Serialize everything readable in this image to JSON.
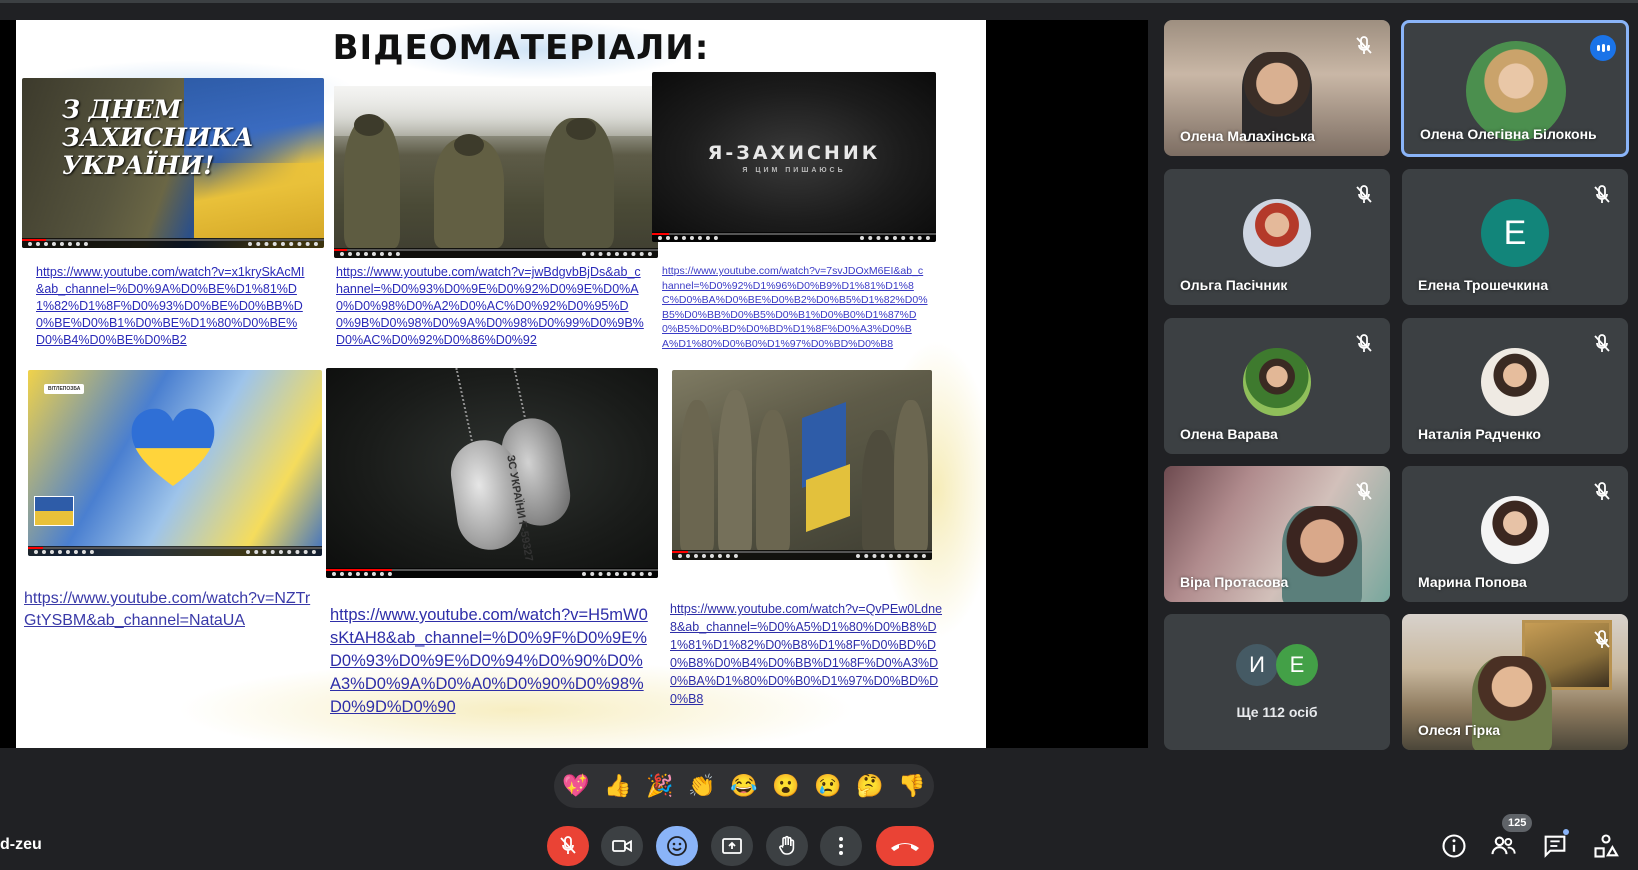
{
  "slide": {
    "title": "ВІДЕОМАТЕРІАЛИ:",
    "thumb1_overlay": "З ДНЕМ\nЗАХИСНИКА\nУКРАЇНИ!",
    "thumb3_big": "Я-ЗАХИСНИК",
    "thumb3_small": "Я ЦИМ ПИШАЮСЬ",
    "thumb4_tag": "ВІТЛЕПОЗБА",
    "thumb5_tagtext": "ЗС УКРАЇНИ Г-59327",
    "links": [
      "https://www.youtube.com/watch?v=x1krySkAcMI&ab_channel=%D0%9A%D0%BE%D1%81%D1%82%D1%8F%D0%93%D0%BE%D0%BB%D0%BE%D0%B1%D0%BE%D1%80%D0%BE%D0%B4%D0%BE%D0%B2",
      "https://www.youtube.com/watch?v=jwBdgvbBjDs&ab_channel=%D0%93%D0%9E%D0%92%D0%9E%D0%A0%D0%98%D0%A2%D0%AC%D0%92%D0%95%D0%9B%D0%98%D0%9A%D0%98%D0%99%D0%9B%D0%AC%D0%92%D0%86%D0%92",
      "https://www.youtube.com/watch?v=7svJDOxM6EI&ab_channel=%D0%92%D1%96%D0%B9%D1%81%D1%8C%D0%BA%D0%BE%D0%B2%D0%B5%D1%82%D0%B5%D0%BB%D0%B5%D0%B1%D0%B0%D1%87%D0%B5%D0%BD%D0%BD%D1%8F%D0%A3%D0%BA%D1%80%D0%B0%D1%97%D0%BD%D0%B8",
      "https://www.youtube.com/watch?v=NZTrGtYSBM&ab_channel=NataUA",
      "https://www.youtube.com/watch?v=H5mW0sKtAH8&ab_channel=%D0%9F%D0%9E%D0%93%D0%9E%D0%94%D0%90%D0%A3%D0%9A%D0%A0%D0%90%D0%98%D0%9D%D0%90",
      "https://www.youtube.com/watch?v=QvPEw0Ldne8&ab_channel=%D0%A5%D1%80%D0%B8%D1%81%D1%82%D0%B8%D1%8F%D0%BD%D0%B8%D0%B4%D0%BB%D1%8F%D0%A3%D0%BA%D1%80%D0%B0%D1%97%D0%BD%D0%B8"
    ]
  },
  "participants": {
    "p1": "Олена Малахінська",
    "p2": "Олена Олегівна Білоконь",
    "p3": "Ольга Пасічник",
    "p4": "Елена Трошечкина",
    "p4_letter": "E",
    "p5": "Олена Варава",
    "p6": "Наталія Радченко",
    "p7": "Віра Протасова",
    "p8": "Марина Попова",
    "more_letter1": "И",
    "more_letter2": "E",
    "more_label": "Ще 112 осіб",
    "p10": "Олеся Гірка"
  },
  "reactions": [
    "💖",
    "👍",
    "🎉",
    "👏",
    "😂",
    "😮",
    "😢",
    "🤔",
    "👎"
  ],
  "bottom": {
    "meeting_code": "d-zeu",
    "people_count": "125"
  },
  "colors": {
    "background": "#202124",
    "tile": "#3c4043",
    "active_border": "#8ab4f8",
    "end_call": "#ea4335",
    "link": "#1a0dab"
  },
  "icons": [
    "mic-off-icon",
    "camera-icon",
    "emoji-icon",
    "present-icon",
    "raise-hand-icon",
    "more-options-icon",
    "end-call-icon",
    "info-icon",
    "people-icon",
    "chat-icon",
    "activities-icon"
  ]
}
